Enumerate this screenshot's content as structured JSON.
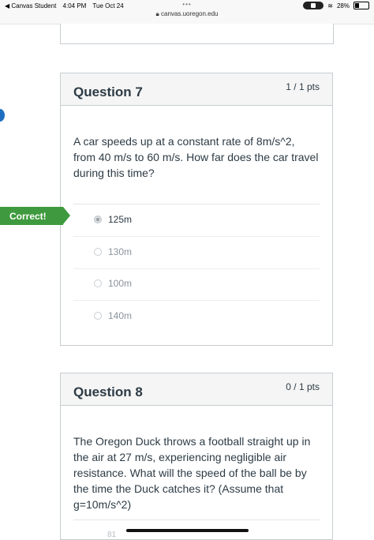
{
  "status_bar": {
    "back_app": "◀ Canvas Student",
    "time": "4:04 PM",
    "date": "Tue Oct 24",
    "dots": "•••",
    "url": "canvas.uoregon.edu",
    "battery": "28%"
  },
  "question7": {
    "title": "Question 7",
    "points": "1 / 1 pts",
    "text": "A car speeds up at a constant rate of 8m/s^2, from 40 m/s to 60 m/s. How far does the car travel during this time?",
    "result_flag": "Correct!",
    "answers": [
      {
        "label": "125m",
        "selected": true
      },
      {
        "label": "130m",
        "selected": false
      },
      {
        "label": "100m",
        "selected": false
      },
      {
        "label": "140m",
        "selected": false
      }
    ]
  },
  "question8": {
    "title": "Question 8",
    "points": "0 / 1 pts",
    "text": "The Oregon Duck throws a football straight up in the air at 27 m/s, experiencing negligible air resistance. What will the speed of the ball be by the time the Duck catches it? (Assume that g=10m/s^2)",
    "partial_answer": "81"
  },
  "colors": {
    "correct_green": "#3f9a3f",
    "header_bg": "#f5f5f5",
    "text": "#2d3b45"
  }
}
